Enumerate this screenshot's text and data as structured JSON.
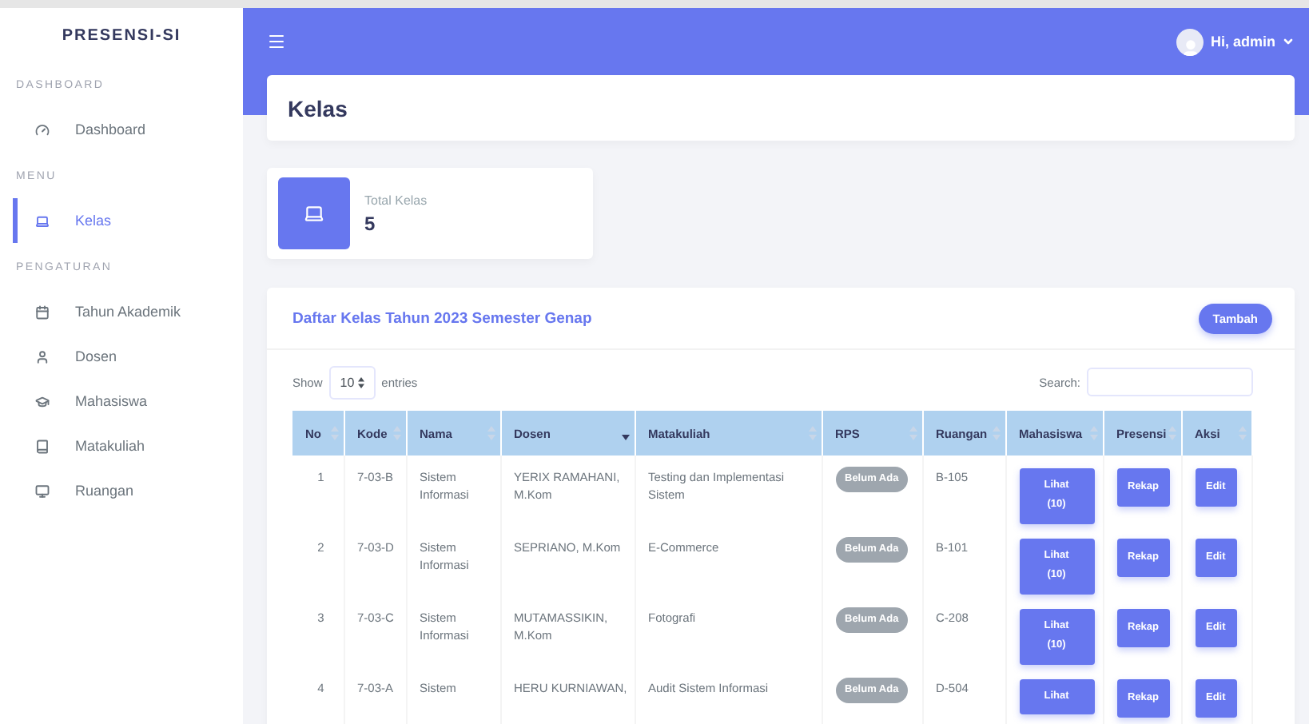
{
  "sidebar": {
    "brand": "PRESENSI-SI",
    "sections": [
      {
        "label": "DASHBOARD",
        "items": [
          {
            "label": "Dashboard",
            "selected": false
          }
        ]
      },
      {
        "label": "MENU",
        "items": [
          {
            "label": "Kelas",
            "selected": true
          }
        ]
      },
      {
        "label": "PENGATURAN",
        "items": [
          {
            "label": "Tahun Akademik",
            "selected": false
          },
          {
            "label": "Dosen",
            "selected": false
          },
          {
            "label": "Mahasiswa",
            "selected": false
          },
          {
            "label": "Matakuliah",
            "selected": false
          },
          {
            "label": "Ruangan",
            "selected": false
          }
        ]
      }
    ]
  },
  "topbar": {
    "greeting": "Hi, admin"
  },
  "page_title": "Kelas",
  "stat": {
    "label": "Total Kelas",
    "value": "5"
  },
  "table_card": {
    "title": "Daftar Kelas Tahun 2023 Semester Genap",
    "add_button": "Tambah",
    "show_label": "Show",
    "page_size": "10",
    "entries_label": "entries",
    "search_label": "Search:",
    "columns": [
      {
        "label": "No",
        "sorted": false
      },
      {
        "label": "Kode",
        "sorted": false
      },
      {
        "label": "Nama",
        "sorted": false
      },
      {
        "label": "Dosen",
        "sorted": true
      },
      {
        "label": "Matakuliah",
        "sorted": false
      },
      {
        "label": "RPS",
        "sorted": false
      },
      {
        "label": "Ruangan",
        "sorted": false
      },
      {
        "label": "Mahasiswa",
        "sorted": false
      },
      {
        "label": "Presensi",
        "sorted": false
      },
      {
        "label": "Aksi",
        "sorted": false
      }
    ],
    "rows": [
      {
        "no": "1",
        "kode": "7-03-B",
        "nama": "Sistem Informasi",
        "dosen": "YERIX RAMAHANI, M.Kom",
        "matakuliah": "Testing dan Implementasi Sistem",
        "rps": "Belum Ada",
        "ruangan": "B-105",
        "lihat": "Lihat",
        "count": "(10)",
        "rekap": "Rekap",
        "edit": "Edit"
      },
      {
        "no": "2",
        "kode": "7-03-D",
        "nama": "Sistem Informasi",
        "dosen": "SEPRIANO, M.Kom",
        "matakuliah": "E-Commerce",
        "rps": "Belum Ada",
        "ruangan": "B-101",
        "lihat": "Lihat",
        "count": "(10)",
        "rekap": "Rekap",
        "edit": "Edit"
      },
      {
        "no": "3",
        "kode": "7-03-C",
        "nama": "Sistem Informasi",
        "dosen": "MUTAMASSIKIN, M.Kom",
        "matakuliah": "Fotografi",
        "rps": "Belum Ada",
        "ruangan": "C-208",
        "lihat": "Lihat",
        "count": "(10)",
        "rekap": "Rekap",
        "edit": "Edit"
      },
      {
        "no": "4",
        "kode": "7-03-A",
        "nama": "Sistem",
        "dosen": "HERU KURNIAWAN,",
        "matakuliah": "Audit Sistem Informasi",
        "rps": "Belum Ada",
        "ruangan": "D-504",
        "lihat": "Lihat",
        "rekap": "Rekap",
        "edit": "Edit"
      }
    ]
  }
}
